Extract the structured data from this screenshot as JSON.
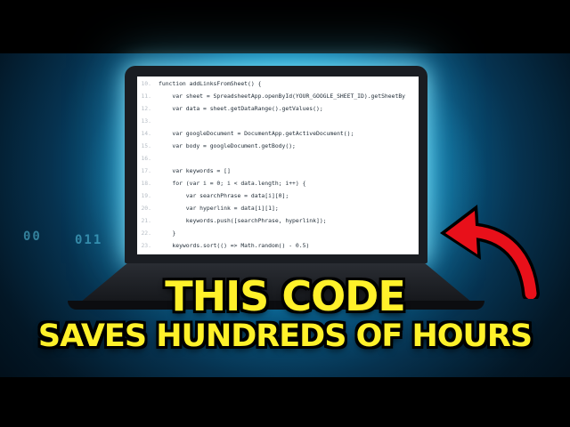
{
  "thumbnail": {
    "headline_line1": "THIS CODE",
    "headline_line2": "SAVES HUNDREDS OF HOURS",
    "binary_text_1": "00",
    "binary_text_2": "011",
    "colors": {
      "headline": "#fff12a",
      "headline_outline": "#000000",
      "arrow": "#e8101a",
      "glow": "#3fe6ff"
    },
    "icons": {
      "arrow": "red-curved-arrow-icon"
    }
  },
  "code_editor": {
    "lines": [
      {
        "number": "10.",
        "code": "function addLinksFromSheet() {"
      },
      {
        "number": "11.",
        "code": "    var sheet = SpreadsheetApp.openById(YOUR_GOOGLE_SHEET_ID).getSheetBy"
      },
      {
        "number": "12.",
        "code": "    var data = sheet.getDataRange().getValues();"
      },
      {
        "number": "13.",
        "code": ""
      },
      {
        "number": "14.",
        "code": "    var googleDocument = DocumentApp.getActiveDocument();"
      },
      {
        "number": "15.",
        "code": "    var body = googleDocument.getBody();"
      },
      {
        "number": "16.",
        "code": ""
      },
      {
        "number": "17.",
        "code": "    var keywords = []"
      },
      {
        "number": "18.",
        "code": "    for (var i = 0; i < data.length; i++) {"
      },
      {
        "number": "19.",
        "code": "        var searchPhrase = data[i][0];"
      },
      {
        "number": "20.",
        "code": "        var hyperlink = data[i][1];"
      },
      {
        "number": "21.",
        "code": "        keywords.push([searchPhrase, hyperlink]);"
      },
      {
        "number": "22.",
        "code": "    }"
      },
      {
        "number": "23.",
        "code": "    keywords.sort(() => Math.random() - 0.5)"
      }
    ]
  }
}
